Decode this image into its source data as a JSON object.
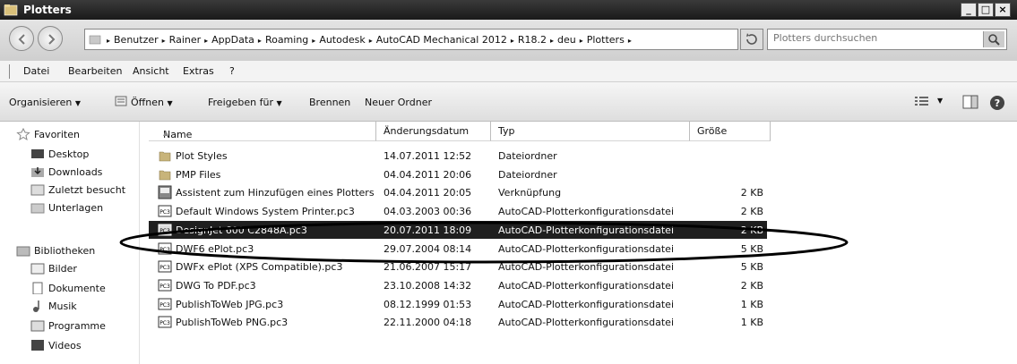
{
  "window": {
    "title": "Plotters"
  },
  "address": {
    "crumbs": [
      "Benutzer",
      "Rainer",
      "AppData",
      "Roaming",
      "Autodesk",
      "AutoCAD Mechanical 2012",
      "R18.2",
      "deu",
      "Plotters"
    ]
  },
  "search": {
    "placeholder": "Plotters durchsuchen"
  },
  "menu": [
    "Datei",
    "Bearbeiten",
    "Ansicht",
    "Extras",
    "?"
  ],
  "toolbar": {
    "organize": "Organisieren",
    "open": "Öffnen",
    "share": "Freigeben für",
    "burn": "Brennen",
    "new_folder": "Neuer Ordner"
  },
  "nav": {
    "favorites": "Favoriten",
    "desktop": "Desktop",
    "downloads": "Downloads",
    "recent": "Zuletzt besucht",
    "docs_folder": "Unterlagen",
    "libraries": "Bibliotheken",
    "pictures": "Bilder",
    "documents": "Dokumente",
    "music": "Musik",
    "programs": "Programme",
    "videos": "Videos"
  },
  "columns": {
    "name": "Name",
    "date": "Änderungsdatum",
    "type": "Typ",
    "size": "Größe"
  },
  "files": [
    {
      "name": "Plot Styles",
      "date": "14.07.2011 12:52",
      "type": "Dateiordner",
      "size": "",
      "icon": "folder-icon"
    },
    {
      "name": "PMP Files",
      "date": "04.04.2011 20:06",
      "type": "Dateiordner",
      "size": "",
      "icon": "folder-icon"
    },
    {
      "name": "Assistent zum Hinzufügen eines Plotters",
      "date": "04.04.2011 20:05",
      "type": "Verknüpfung",
      "size": "2 KB",
      "icon": "wizard-shortcut-icon"
    },
    {
      "name": "Default Windows System Printer.pc3",
      "date": "04.03.2003 00:36",
      "type": "AutoCAD-Plotterkonfigurationsdatei",
      "size": "2 KB",
      "icon": "pc3-file-icon"
    },
    {
      "name": "DesignJet 600 C2848A.pc3",
      "date": "20.07.2011 18:09",
      "type": "AutoCAD-Plotterkonfigurationsdatei",
      "size": "2 KB",
      "icon": "pc3-file-icon"
    },
    {
      "name": "DWF6 ePlot.pc3",
      "date": "29.07.2004 08:14",
      "type": "AutoCAD-Plotterkonfigurationsdatei",
      "size": "5 KB",
      "icon": "pc3-file-icon"
    },
    {
      "name": "DWFx ePlot (XPS Compatible).pc3",
      "date": "21.06.2007 15:17",
      "type": "AutoCAD-Plotterkonfigurationsdatei",
      "size": "5 KB",
      "icon": "pc3-file-icon"
    },
    {
      "name": "DWG To PDF.pc3",
      "date": "23.10.2008 14:32",
      "type": "AutoCAD-Plotterkonfigurationsdatei",
      "size": "2 KB",
      "icon": "pc3-file-icon"
    },
    {
      "name": "PublishToWeb JPG.pc3",
      "date": "08.12.1999 01:53",
      "type": "AutoCAD-Plotterkonfigurationsdatei",
      "size": "1 KB",
      "icon": "pc3-file-icon"
    },
    {
      "name": "PublishToWeb PNG.pc3",
      "date": "22.11.2000 04:18",
      "type": "AutoCAD-Plotterkonfigurationsdatei",
      "size": "1 KB",
      "icon": "pc3-file-icon"
    }
  ],
  "selected_file": "DesignJet 600 C2848A.pc3",
  "annotation_icon": "highlight-ellipse"
}
